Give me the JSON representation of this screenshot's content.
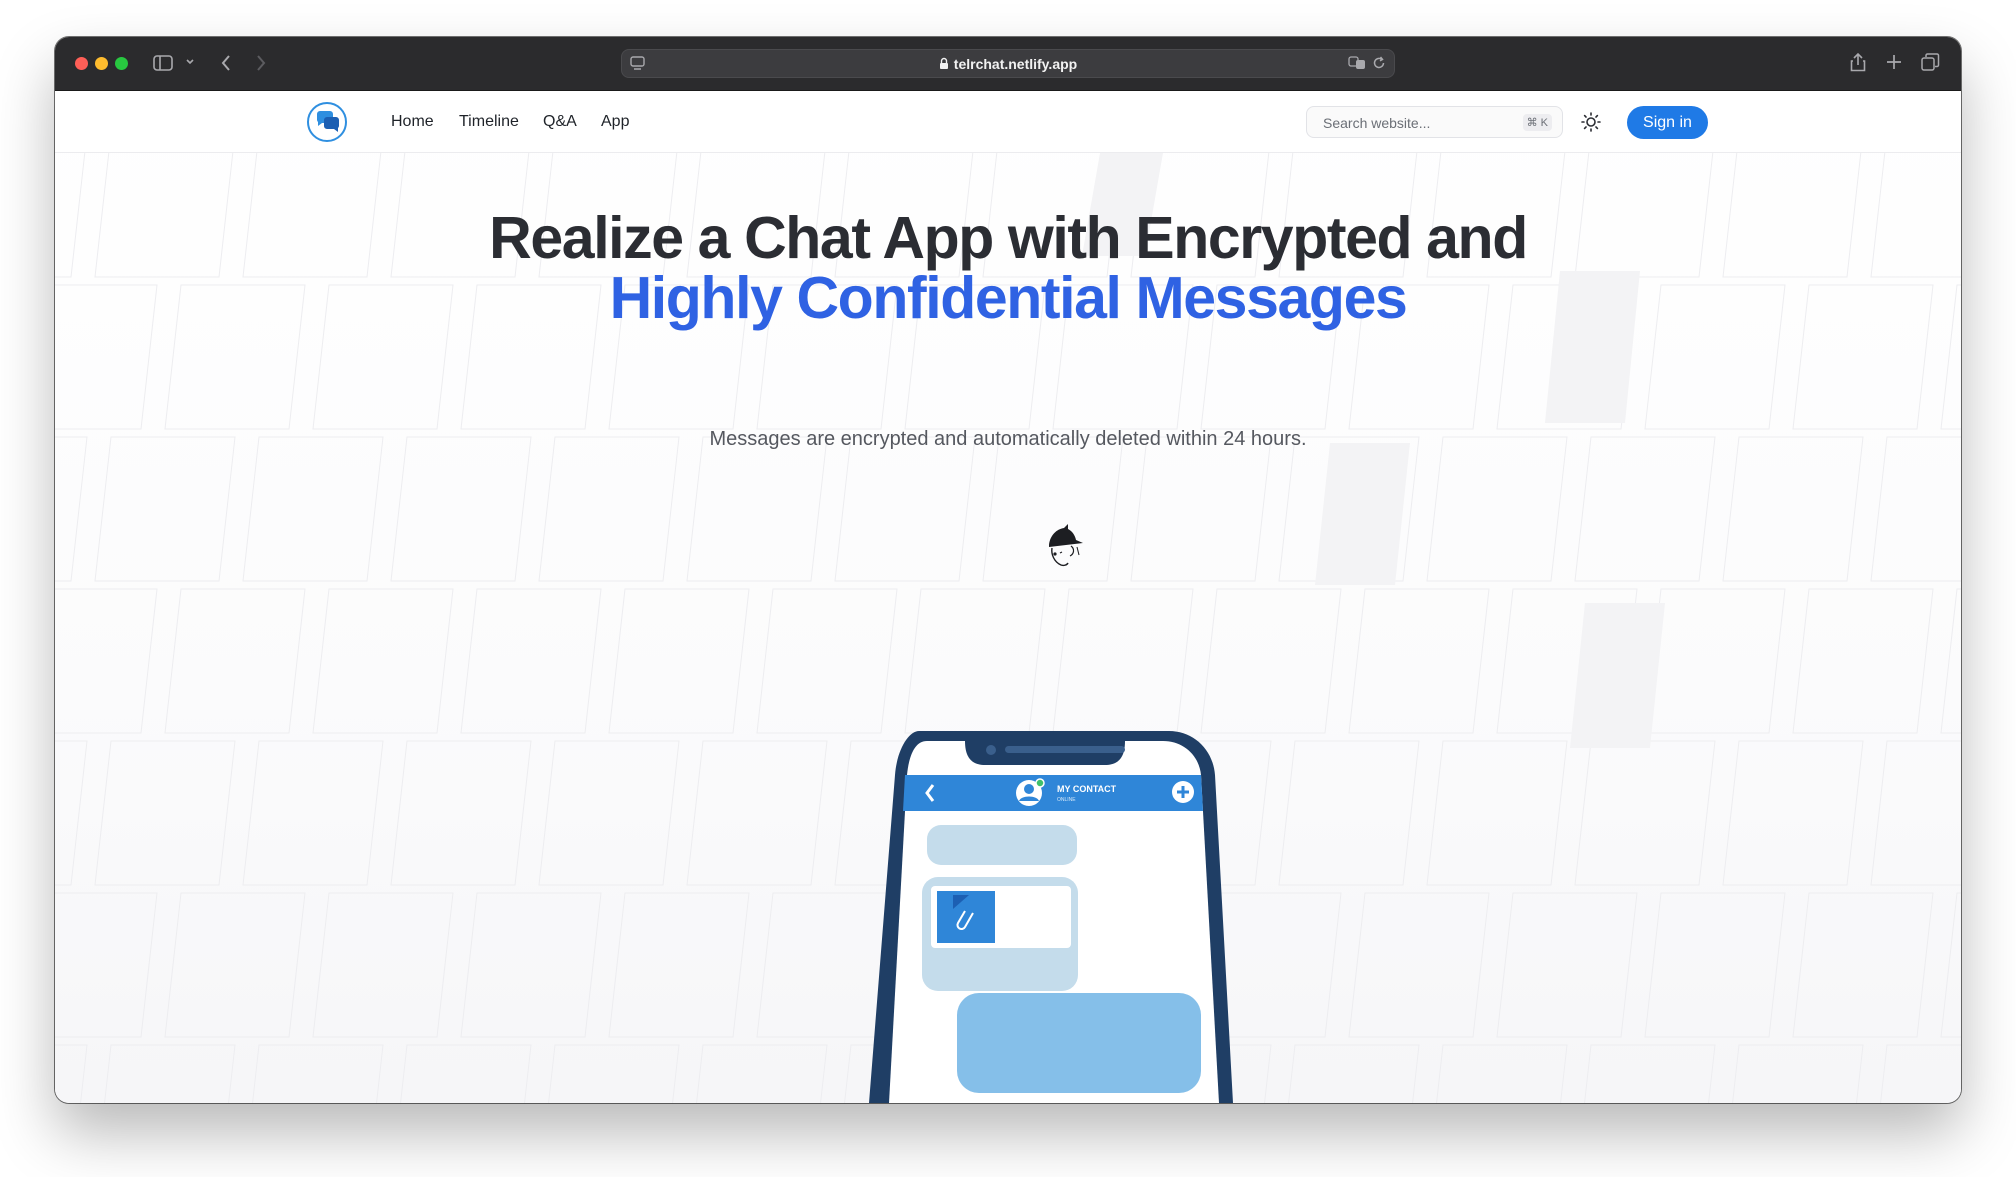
{
  "browser": {
    "url": "telrchat.netlify.app"
  },
  "nav": {
    "links": [
      "Home",
      "Timeline",
      "Q&A",
      "App"
    ],
    "search_placeholder": "Search website...",
    "search_shortcut": "⌘ K",
    "signin_label": "Sign in"
  },
  "hero": {
    "title_line1": "Realize a Chat App with Encrypted and",
    "title_line2": "Highly Confidential Messages",
    "subtitle": "Messages are encrypted and automatically deleted within 24 hours."
  },
  "phone": {
    "contact_name": "MY CONTACT",
    "contact_status": "ONLINE"
  },
  "colors": {
    "accent": "#2f62e3",
    "button": "#1f7ae6",
    "phone_header": "#2f86d8",
    "bubble_light": "#c4dceb",
    "bubble_blue": "#85bfe9"
  }
}
